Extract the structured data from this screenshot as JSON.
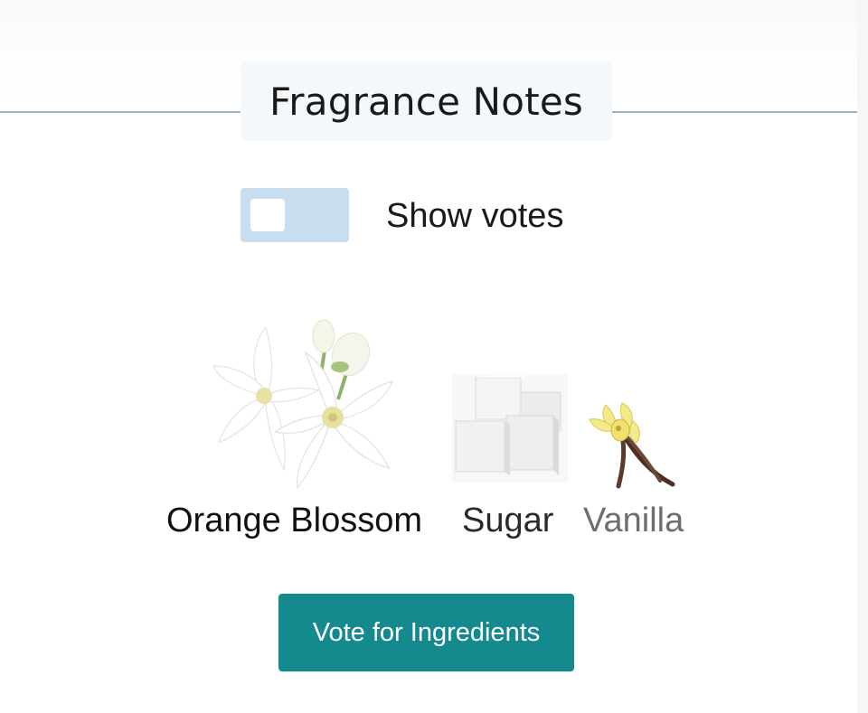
{
  "section": {
    "title": "Fragrance Notes"
  },
  "votes_toggle": {
    "label": "Show votes",
    "checked": false
  },
  "notes": [
    {
      "name": "Orange Blossom",
      "icon": "orange-blossom-image",
      "label_color": "#111111"
    },
    {
      "name": "Sugar",
      "icon": "sugar-cubes-image",
      "label_color": "#2a2a2a"
    },
    {
      "name": "Vanilla",
      "icon": "vanilla-image",
      "label_color": "#6e6e6e"
    }
  ],
  "actions": {
    "vote_label": "Vote for Ingredients"
  },
  "colors": {
    "accent": "#14898e",
    "toggle_track": "#c9dff0",
    "divider": "#9db4c4"
  }
}
